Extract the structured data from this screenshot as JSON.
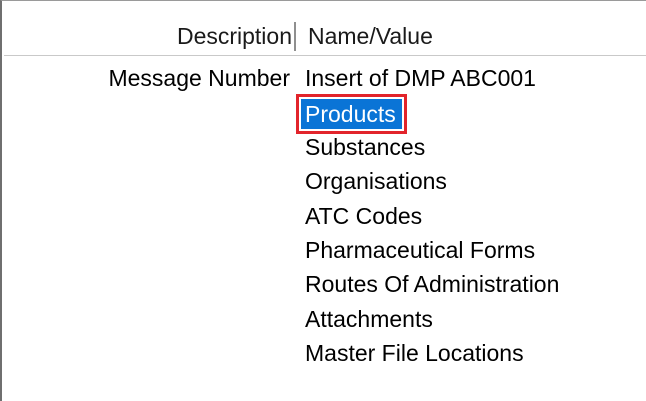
{
  "columns": {
    "description_header": "Description",
    "value_header": "Name/Value"
  },
  "row": {
    "description": "Message Number",
    "items": [
      {
        "label": "Insert of DMP ABC001",
        "selected": false
      },
      {
        "label": "Products",
        "selected": true
      },
      {
        "label": "Substances",
        "selected": false
      },
      {
        "label": "Organisations",
        "selected": false
      },
      {
        "label": "ATC Codes",
        "selected": false
      },
      {
        "label": "Pharmaceutical Forms",
        "selected": false
      },
      {
        "label": "Routes Of Administration",
        "selected": false
      },
      {
        "label": "Attachments",
        "selected": false
      },
      {
        "label": "Master File Locations",
        "selected": false
      }
    ]
  },
  "colors": {
    "selection_background": "#0a74d6",
    "selection_text": "#ffffff",
    "highlight_outline": "#e2242b"
  }
}
